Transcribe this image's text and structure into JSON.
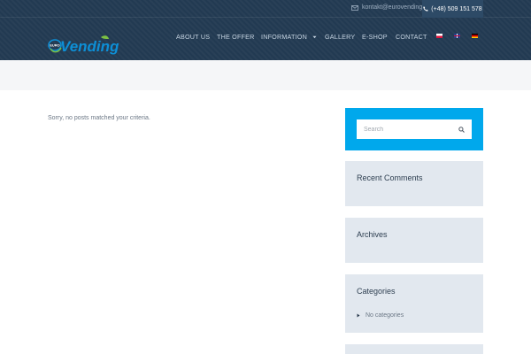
{
  "topbar": {
    "email": "kontakt@eurovending.pl",
    "phone": "(+48) 509 151 578"
  },
  "logo": {
    "small_text": "EURO",
    "brand": "Vending"
  },
  "nav": {
    "items": [
      {
        "label": "ABOUT US"
      },
      {
        "label": "THE OFFER"
      },
      {
        "label": "INFORMATION"
      },
      {
        "label": "GALLERY"
      },
      {
        "label": "E-SHOP"
      },
      {
        "label": "CONTACT"
      }
    ]
  },
  "main": {
    "no_posts_text": "Sorry, no posts matched your criteria."
  },
  "sidebar": {
    "search_placeholder": "Search",
    "recent_comments_title": "Recent Comments",
    "archives_title": "Archives",
    "categories_title": "Categories",
    "categories_item": "No categories"
  },
  "colors": {
    "header": "#223a52",
    "accent": "#00a8ec",
    "widget_bg": "#e2e8ef",
    "logo_blue": "#0d8fd6",
    "logo_green": "#7cc142"
  }
}
